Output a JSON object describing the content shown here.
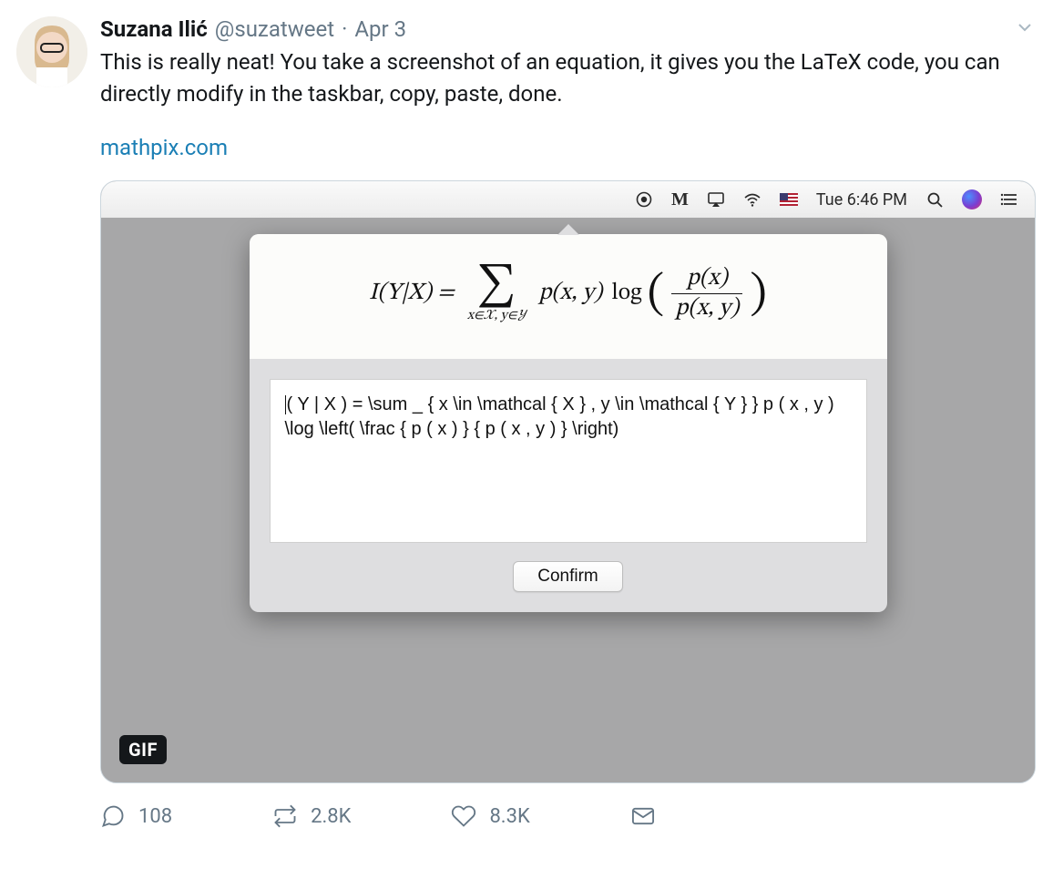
{
  "tweet": {
    "author": {
      "display_name": "Suzana Ilić",
      "handle": "@suzatweet"
    },
    "separator": "·",
    "date": "Apr 3",
    "text": "This is really neat! You take a screenshot of an equation, it gives you the LaTeX code, you can directly modify in the taskbar, copy, paste, done.",
    "link_text": "mathpix.com",
    "gif_badge": "GIF",
    "actions": {
      "reply_count": "108",
      "retweet_count": "2.8K",
      "like_count": "8.3K"
    }
  },
  "mac": {
    "clock": "Tue 6:46 PM",
    "popover": {
      "equation": {
        "lhs": "I(Y|X) =",
        "sigma": "∑",
        "sum_sub": "x∈𝒳, y∈𝒴",
        "mid_pxy": "p(x, y)",
        "log_label": "log",
        "frac_num": "p(x)",
        "frac_den": "p(x, y)"
      },
      "latex_text": "( Y | X ) = \\sum _ { x \\in \\mathcal { X } , y \\in \\mathcal { Y } } p ( x , y ) \\log \\left( \\frac { p ( x ) } { p ( x , y ) } \\right)",
      "confirm_label": "Confirm"
    }
  }
}
